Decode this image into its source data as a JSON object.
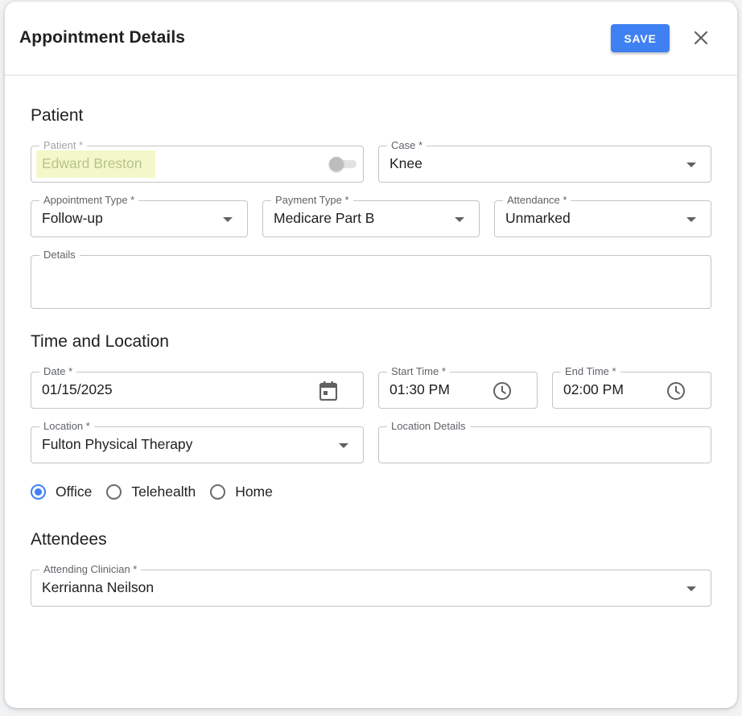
{
  "dialog": {
    "title": "Appointment Details",
    "save_label": "SAVE"
  },
  "patient_section": {
    "title": "Patient",
    "patient": {
      "label": "Patient *",
      "value": "Edward Breston"
    },
    "case": {
      "label": "Case *",
      "value": "Knee"
    },
    "appointment_type": {
      "label": "Appointment Type *",
      "value": "Follow-up"
    },
    "payment_type": {
      "label": "Payment Type *",
      "value": "Medicare Part B"
    },
    "attendance": {
      "label": "Attendance *",
      "value": "Unmarked"
    },
    "details": {
      "label": "Details",
      "value": ""
    }
  },
  "time_section": {
    "title": "Time and Location",
    "date": {
      "label": "Date *",
      "value": "01/15/2025"
    },
    "start_time": {
      "label": "Start Time *",
      "value": "01:30 PM"
    },
    "end_time": {
      "label": "End Time *",
      "value": "02:00 PM"
    },
    "location": {
      "label": "Location *",
      "value": "Fulton Physical Therapy"
    },
    "location_details": {
      "label": "Location Details",
      "value": ""
    },
    "visit_modes": [
      {
        "label": "Office",
        "checked": true
      },
      {
        "label": "Telehealth",
        "checked": false
      },
      {
        "label": "Home",
        "checked": false
      }
    ]
  },
  "attendees_section": {
    "title": "Attendees",
    "clinician": {
      "label": "Attending Clinician *",
      "value": "Kerrianna Neilson"
    }
  },
  "icons": {
    "close": "close-icon",
    "calendar": "calendar-icon",
    "clock": "clock-icon",
    "dropdown": "chevron-down-icon",
    "toggle": "toggle-switch"
  },
  "colors": {
    "accent": "#3f80f3",
    "patient_highlight": "#f4f7c9",
    "border": "#c4c4c4"
  }
}
